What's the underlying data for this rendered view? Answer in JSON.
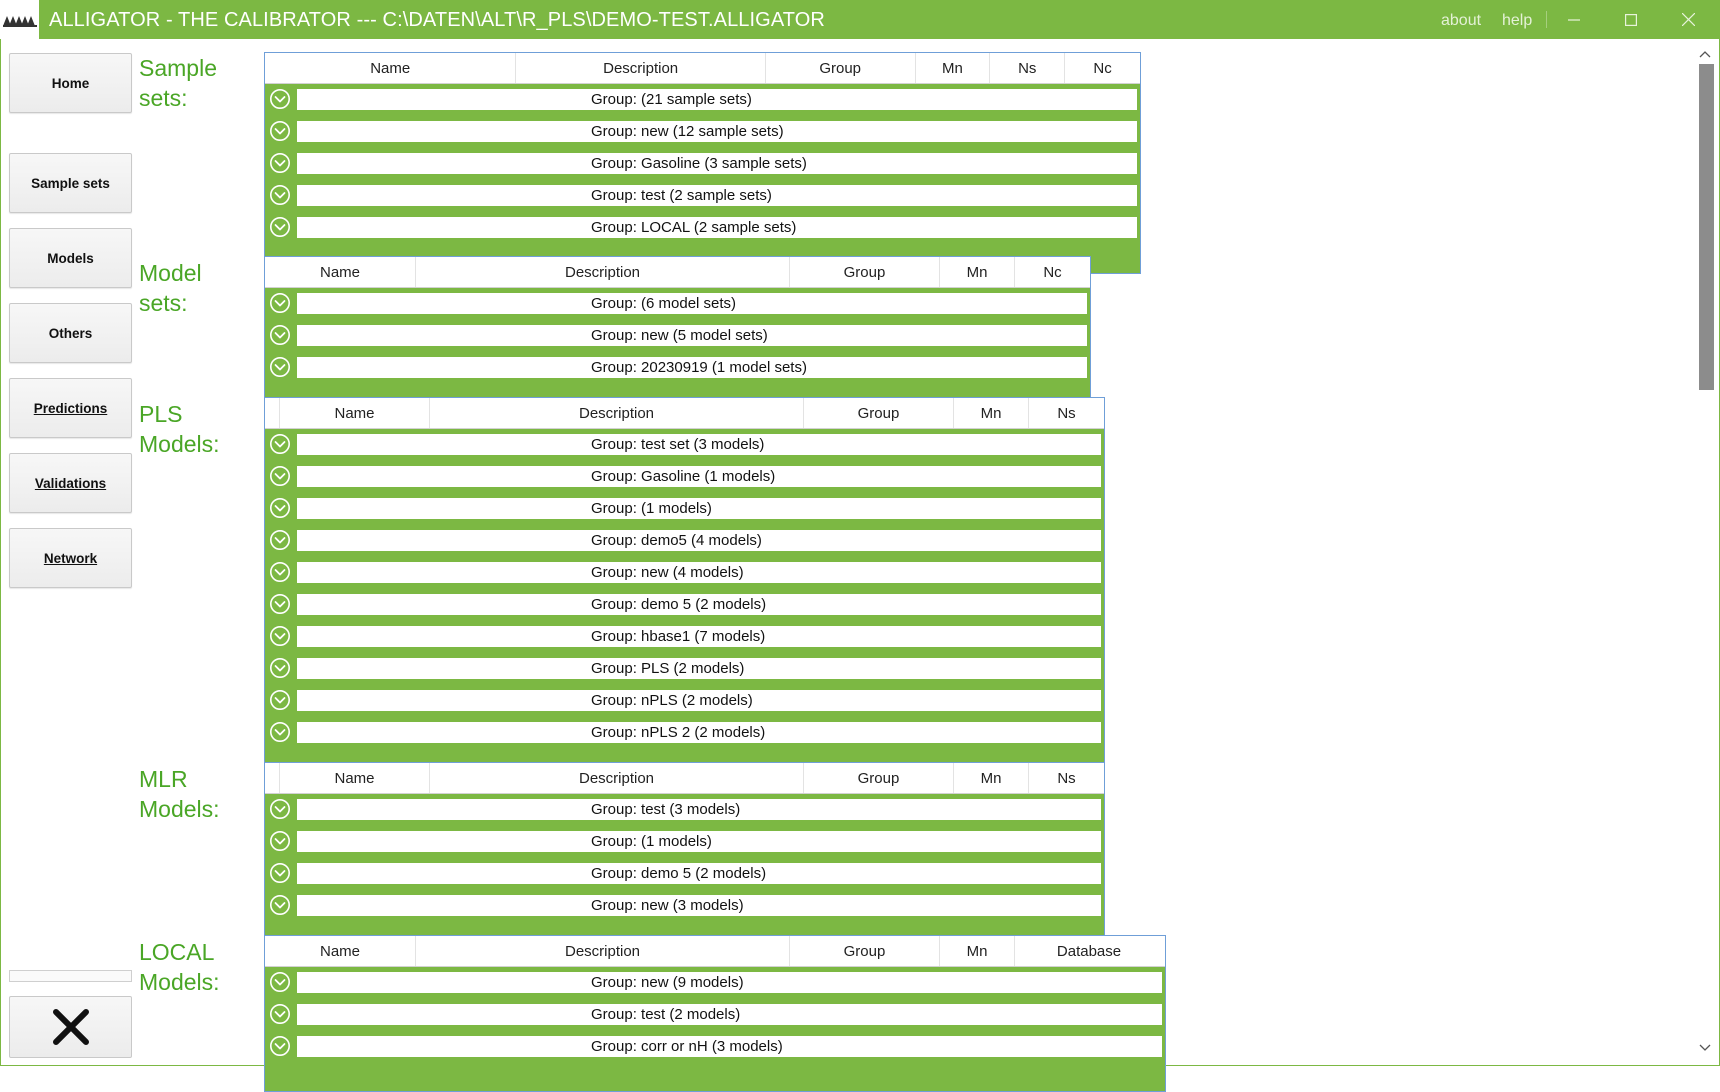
{
  "window": {
    "title": "ALLIGATOR - THE CALIBRATOR --- C:\\DATEN\\ALT\\R_PLS\\DEMO-TEST.ALLIGATOR",
    "about_label": "about",
    "help_label": "help",
    "accent_color": "#7cb843",
    "label_color": "#4aa626"
  },
  "nav": {
    "home": "Home",
    "sample_sets": "Sample sets",
    "models": "Models",
    "others": "Others",
    "predictions": "Predictions",
    "validations": "Validations",
    "network": "Network"
  },
  "sections": [
    {
      "label": "Sample\nsets:",
      "columns": [
        "Name",
        "Description",
        "Group",
        "Mn",
        "Ns",
        "Nc"
      ],
      "groups": [
        "Group:  (21 sample sets)",
        "Group: new (12 sample sets)",
        "Group: Gasoline (3 sample sets)",
        "Group: test (2 sample sets)",
        "Group: LOCAL (2 sample sets)"
      ]
    },
    {
      "label": "Model\nsets:",
      "columns": [
        "Name",
        "Description",
        "Group",
        "Mn",
        "Nc"
      ],
      "groups": [
        "Group:  (6 model sets)",
        "Group: new (5 model sets)",
        "Group: 20230919 (1 model sets)"
      ]
    },
    {
      "label": "PLS\nModels:",
      "columns": [
        "Name",
        "Description",
        "Group",
        "Mn",
        "Ns"
      ],
      "groups": [
        "Group: test set (3 models)",
        "Group: Gasoline (1 models)",
        "Group:  (1 models)",
        "Group: demo5 (4 models)",
        "Group: new (4 models)",
        "Group: demo 5 (2 models)",
        "Group: hbase1 (7 models)",
        "Group: PLS (2 models)",
        "Group: nPLS (2 models)",
        "Group: nPLS 2 (2 models)"
      ]
    },
    {
      "label": "MLR\nModels:",
      "columns": [
        "Name",
        "Description",
        "Group",
        "Mn",
        "Ns"
      ],
      "groups": [
        "Group: test (3 models)",
        "Group:  (1 models)",
        "Group: demo 5 (2 models)",
        "Group: new (3 models)"
      ]
    },
    {
      "label": "LOCAL\nModels:",
      "columns": [
        "Name",
        "Description",
        "Group",
        "Mn",
        "Database"
      ],
      "groups": [
        "Group: new (9 models)",
        "Group: test (2 models)",
        "Group: corr or nH (3 models)"
      ]
    }
  ]
}
